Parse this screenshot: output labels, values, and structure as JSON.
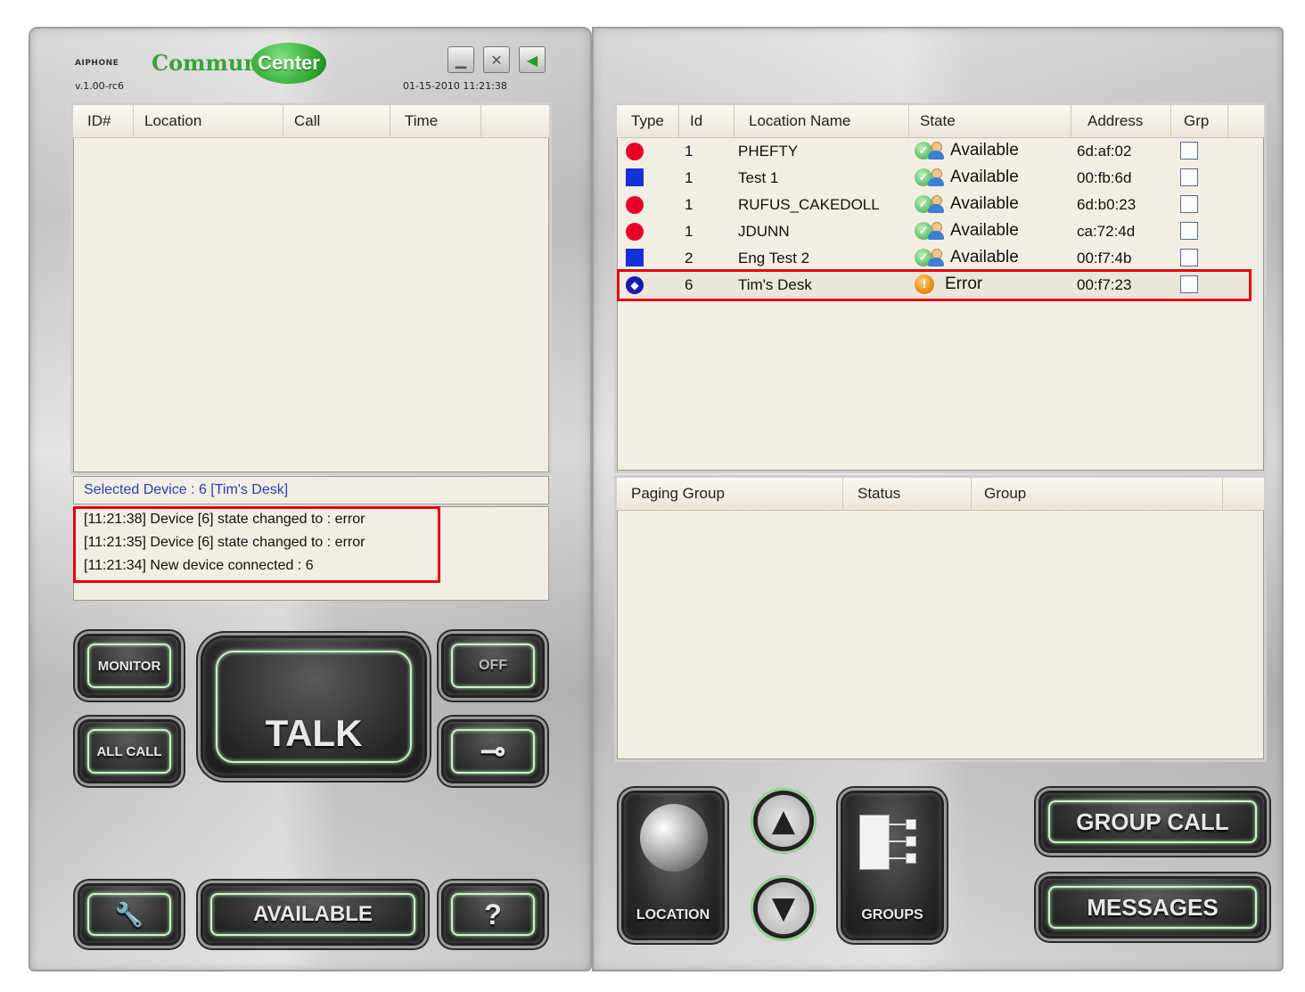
{
  "app": {
    "brand_mark": "AIPHONE",
    "brand_name_left": "Commun",
    "brand_name_right": "Center",
    "version": "v.1.00-rc6",
    "datetime": "01-15-2010 11:21:38"
  },
  "window_controls": {
    "minimize_glyph": "▁",
    "close_glyph": "✕",
    "back_glyph": "◀"
  },
  "call_list": {
    "columns": [
      "ID#",
      "Location",
      "Call",
      "Time"
    ]
  },
  "selected_device": "Selected Device : 6  [Tim's Desk]",
  "log": [
    "[11:21:38] Device [6] state changed to : error",
    "[11:21:35] Device [6] state changed to : error",
    "[11:21:34] New device connected : 6"
  ],
  "left_buttons": {
    "monitor": "MONITOR",
    "all_call": "ALL CALL",
    "talk": "TALK",
    "off": "OFF",
    "door_glyph": "⊸",
    "wrench_glyph": "🔧",
    "available": "AVAILABLE",
    "help": "?"
  },
  "device_list": {
    "columns": [
      "Type",
      "Id",
      "Location Name",
      "State",
      "Address",
      "Grp"
    ],
    "rows": [
      {
        "type": "circle",
        "id": "1",
        "name": "PHEFTY",
        "state": "Available",
        "address": "6d:af:02"
      },
      {
        "type": "square",
        "id": "1",
        "name": "Test 1",
        "state": "Available",
        "address": "00:fb:6d"
      },
      {
        "type": "circle",
        "id": "1",
        "name": "RUFUS_CAKEDOLL",
        "state": "Available",
        "address": "6d:b0:23"
      },
      {
        "type": "circle",
        "id": "1",
        "name": "JDUNN",
        "state": "Available",
        "address": "ca:72:4d"
      },
      {
        "type": "square",
        "id": "2",
        "name": "Eng Test 2",
        "state": "Available",
        "address": "00:f7:4b"
      },
      {
        "type": "target",
        "id": "6",
        "name": "Tim's Desk",
        "state": "Error",
        "address": "00:f7:23"
      }
    ]
  },
  "paging_list": {
    "columns": [
      "Paging Group",
      "Status",
      "Group"
    ]
  },
  "right_buttons": {
    "location": "LOCATION",
    "up_glyph": "▲",
    "down_glyph": "▼",
    "groups": "GROUPS",
    "group_call": "GROUP CALL",
    "messages": "MESSAGES"
  },
  "colors": {
    "accent_green": "#3aa23a",
    "highlight_red": "#e3000f",
    "selected_text": "#2a3fb0",
    "list_bg": "#f3eee4"
  }
}
